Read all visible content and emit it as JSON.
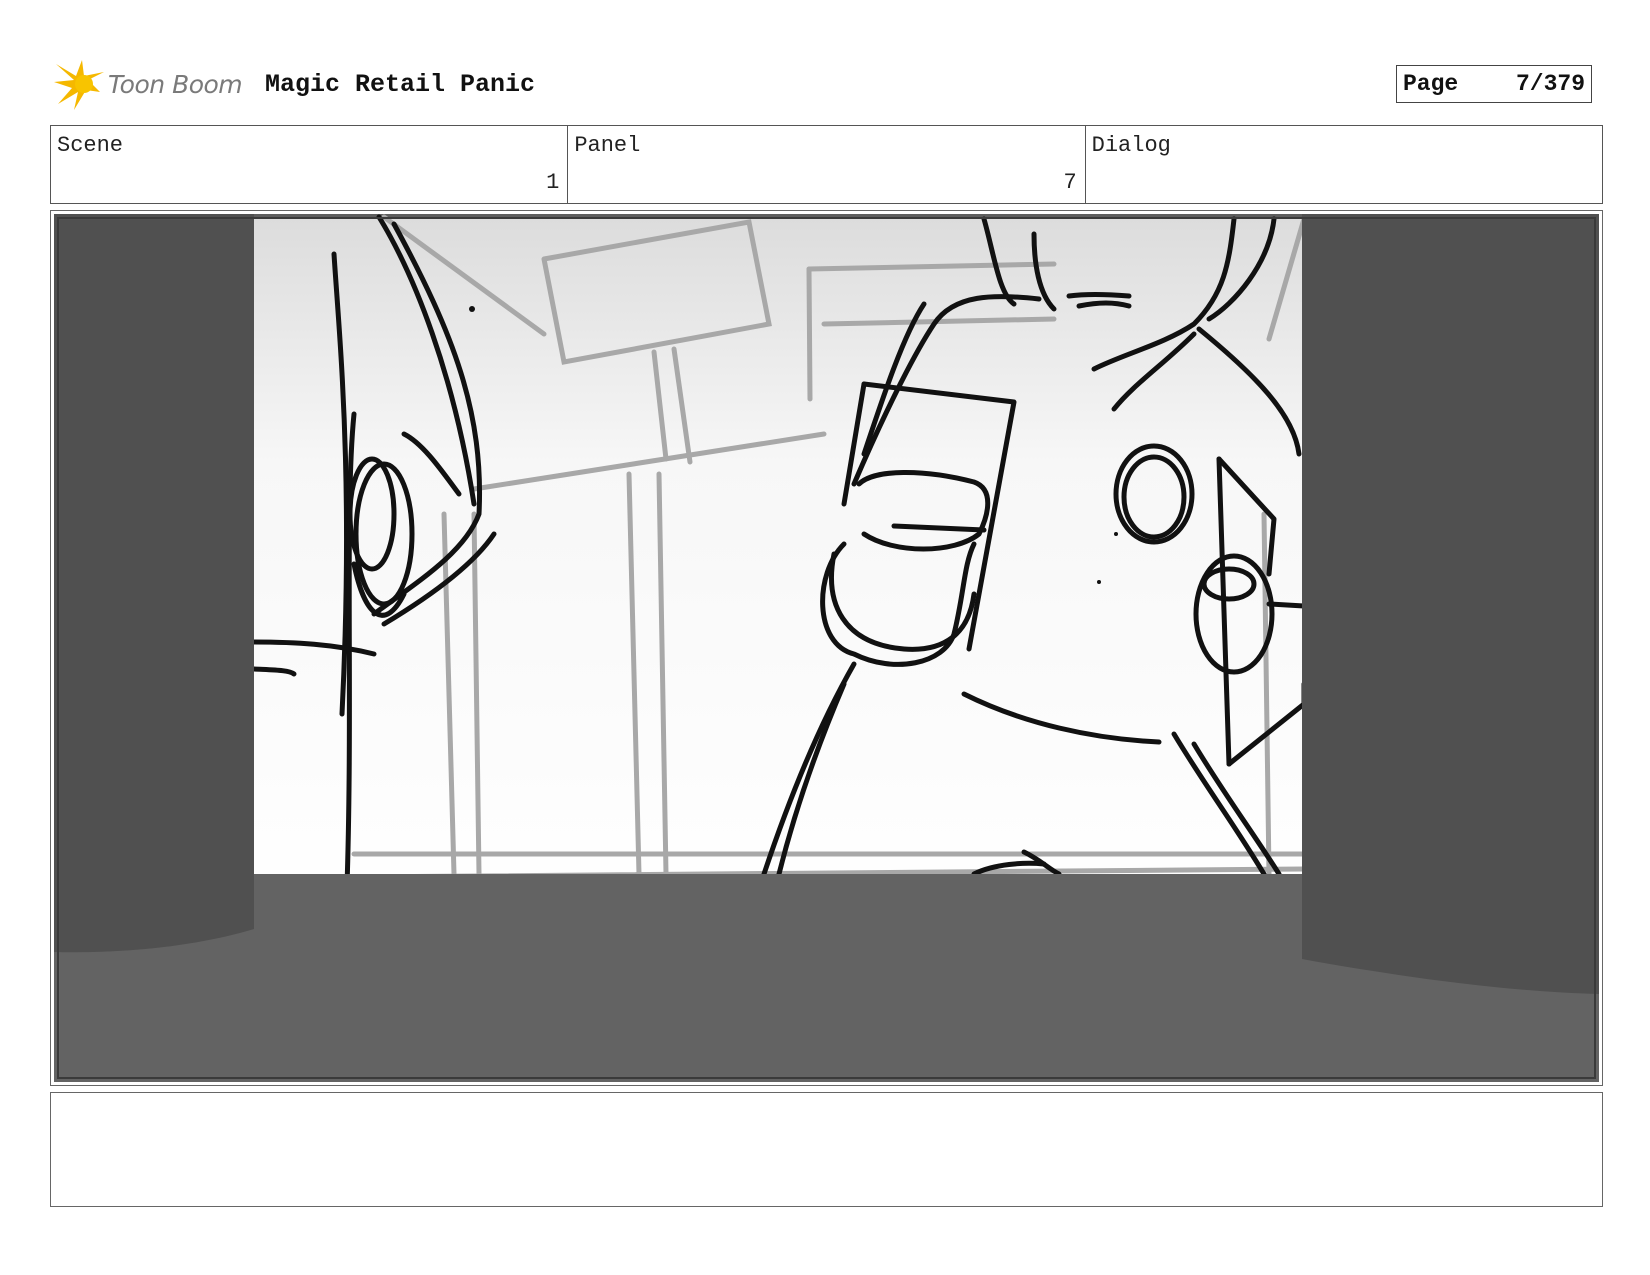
{
  "header": {
    "logo_text": "Toon Boom",
    "project_title": "Magic Retail Panic",
    "page_label": "Page",
    "page_value": "7/379"
  },
  "info": {
    "scene_label": "Scene",
    "scene_value": "1",
    "panel_label": "Panel",
    "panel_value": "7",
    "dialog_label": "Dialog",
    "dialog_value": ""
  },
  "notes": {
    "text": ""
  },
  "colors": {
    "logo_accent": "#f5b800",
    "frame_dark": "#4f4f4f",
    "floor_dark": "#636363",
    "sketch_line": "#111111",
    "background_line": "#a8a8a8"
  }
}
